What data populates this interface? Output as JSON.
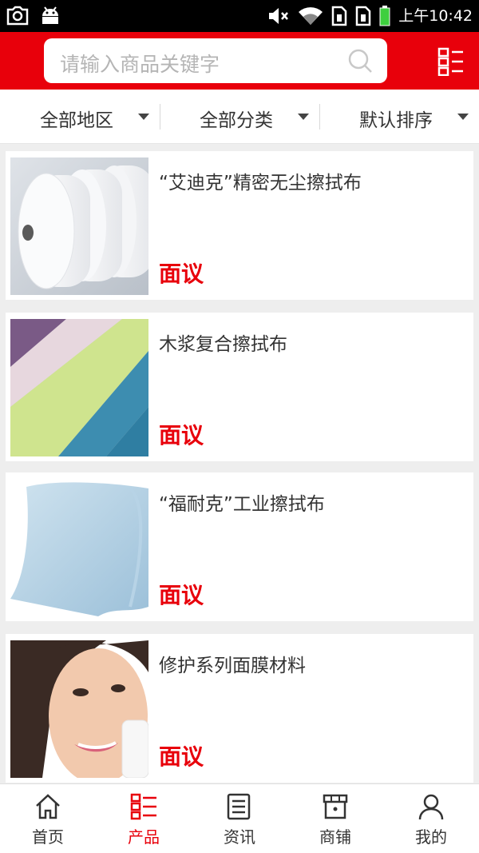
{
  "status_bar": {
    "time": "上午10:42",
    "icons": [
      "screenshot-icon",
      "android-icon",
      "mute-icon",
      "wifi-icon",
      "sim1-icon",
      "sim2-icon",
      "battery-icon"
    ]
  },
  "header": {
    "search_placeholder": "请输入商品关键字",
    "menu_icon": "grid-list-icon",
    "brand_color": "#e8000b"
  },
  "filters": [
    {
      "label": "全部地区"
    },
    {
      "label": "全部分类"
    },
    {
      "label": "默认排序"
    }
  ],
  "products": [
    {
      "title": "“艾迪克”精密无尘擦拭布",
      "price": "面议",
      "image": "white-cloth-rolls"
    },
    {
      "title": "木浆复合擦拭布",
      "price": "面议",
      "image": "colored-fabric-sheets"
    },
    {
      "title": "“福耐克”工业擦拭布",
      "price": "面议",
      "image": "blue-cloth-roll"
    },
    {
      "title": "修护系列面膜材料",
      "price": "面议",
      "image": "woman-face-wipe"
    }
  ],
  "tabbar": {
    "active_index": 1,
    "items": [
      {
        "label": "首页",
        "icon": "home-icon"
      },
      {
        "label": "产品",
        "icon": "product-list-icon"
      },
      {
        "label": "资讯",
        "icon": "news-icon"
      },
      {
        "label": "商铺",
        "icon": "shop-icon"
      },
      {
        "label": "我的",
        "icon": "user-icon"
      }
    ]
  }
}
